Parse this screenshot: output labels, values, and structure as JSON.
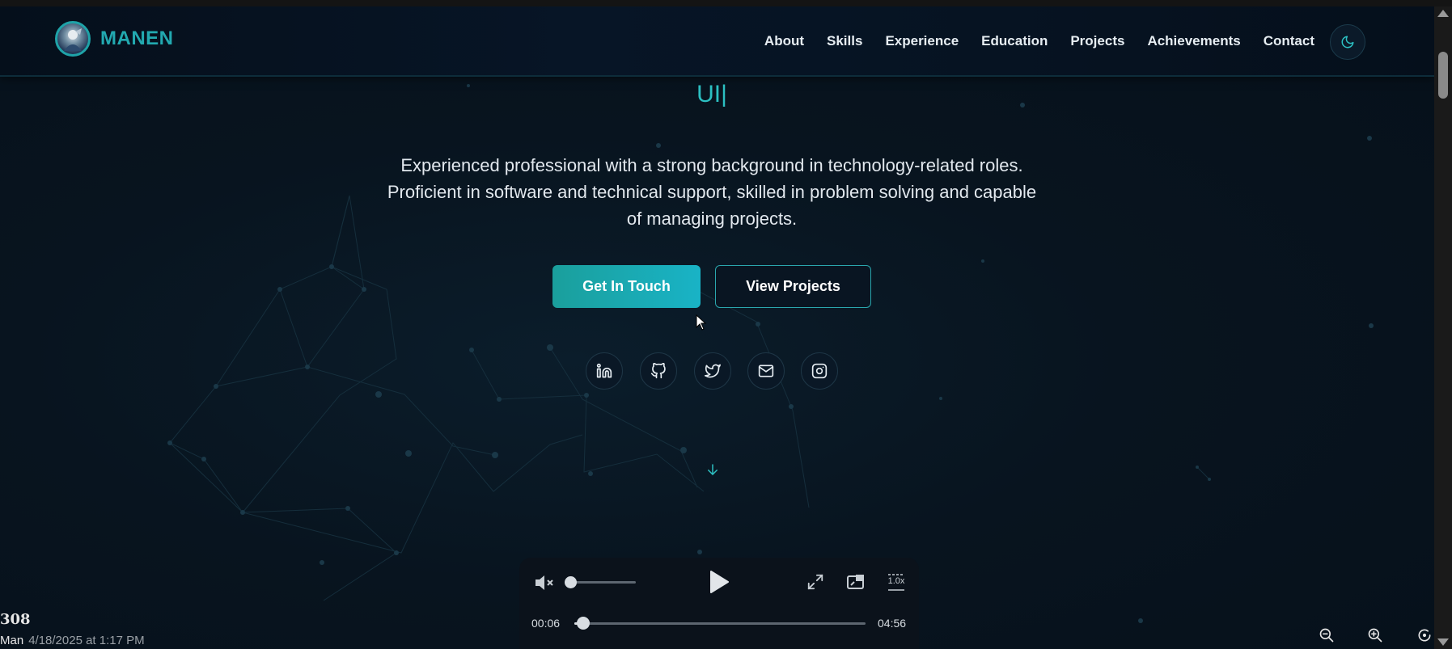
{
  "brand": {
    "name": "MANEN"
  },
  "nav": {
    "items": [
      "About",
      "Skills",
      "Experience",
      "Education",
      "Projects",
      "Achievements",
      "Contact"
    ]
  },
  "theme_toggle": {
    "icon": "moon-icon"
  },
  "hero": {
    "typed_text": "UI|",
    "description": "Experienced professional with a strong background in technology-related roles. Proficient in software and technical support, skilled in problem solving and capable of managing projects.",
    "primary_button": "Get In Touch",
    "secondary_button": "View Projects",
    "socials": [
      "linkedin-icon",
      "github-icon",
      "twitter-icon",
      "mail-icon",
      "instagram-icon"
    ]
  },
  "colors": {
    "accent": "#22a9b0",
    "background": "#07111d",
    "text": "#e6edf2"
  },
  "player": {
    "current_time": "00:06",
    "duration": "04:56",
    "progress": 0.02,
    "volume": 0.0,
    "muted": true,
    "speed": "1.0x"
  },
  "footer": {
    "number": "308",
    "name": "Man",
    "datetime": "4/18/2025 at 1:17 PM"
  }
}
